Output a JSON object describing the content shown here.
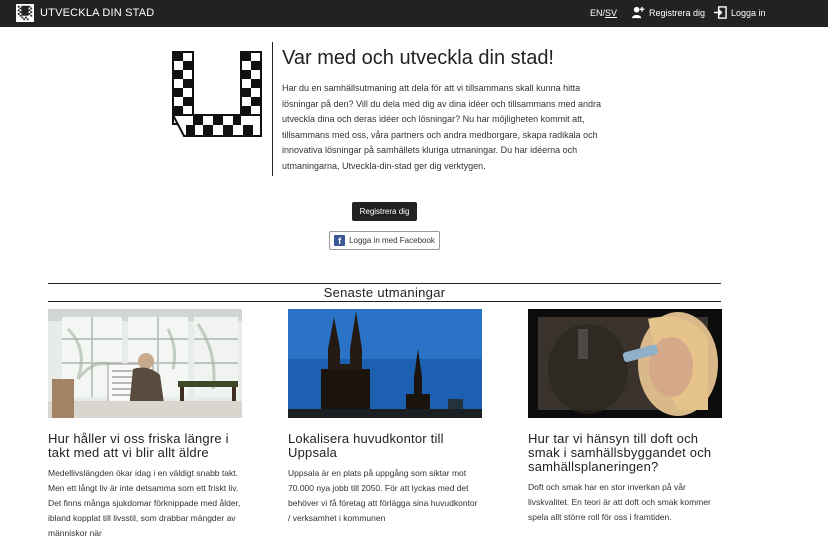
{
  "topbar": {
    "brand": "UTVECKLA DIN STAD",
    "lang_en": "EN",
    "lang_sep": "/",
    "lang_sv": "SV",
    "register": "Registrera dig",
    "login": "Logga in"
  },
  "hero": {
    "title": "Var med och utveckla din stad!",
    "text": "Har du en samhällsutmaning att dela för att vi tillsammans skall kunna hitta lösningar på den? Vill du dela med dig av dina idéer och tillsammans med andra utveckla dina och deras idéer och lösningar? Nu har möjligheten kommit att, tillsammans med oss, våra partners och andra medborgare, skapa radikala och innovativa lösningar på samhällets kluriga utmaningar. Du har idéerna och utmaningarna, Utveckla-din-stad ger dig verktygen.",
    "register_button": "Registrera dig",
    "facebook_button": "Logga in med Facebook"
  },
  "section": {
    "title": "Senaste utmaningar"
  },
  "cards": [
    {
      "title": "Hur håller vi oss friska längre i takt med att vi blir allt äldre",
      "text": "Medellivslängden ökar idag i en väldigt snabb takt. Men ett långt liv är inte detsamma som ett friskt liv. Det finns många sjukdomar förknippade med ålder, ibland kopplat till livsstil, som drabbar mängder av människor när"
    },
    {
      "title": "Lokalisera huvudkontor till Uppsala",
      "text": "Uppsala är en plats på uppgång som siktar mot 70.000 nya jobb till 2050. För att lyckas med det behöver vi få företag att förlägga sina huvudkontor / verksamhet i kommunen"
    },
    {
      "title": "Hur tar vi hänsyn till doft och smak i samhällsbyggandet och samhällsplaneringen?",
      "text": "Doft och smak har en stor inverkan på vår livskvalitet. En teori är att doft och smak kommer spela allt större roll för oss i framtiden."
    }
  ],
  "icons": {
    "brand": "checkered-u-logo-icon",
    "register": "user-plus-icon",
    "login": "sign-in-icon",
    "facebook": "facebook-icon"
  },
  "colors": {
    "topbar": "#222222",
    "primary_button": "#222222",
    "facebook": "#3b5998"
  }
}
